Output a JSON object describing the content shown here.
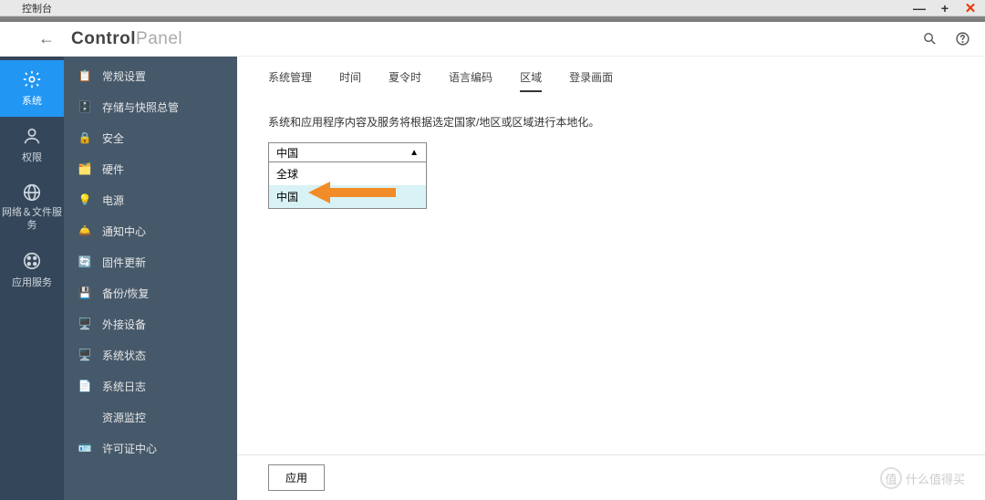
{
  "window": {
    "title": "控制台"
  },
  "header": {
    "brand_strong": "Control",
    "brand_light": "Panel"
  },
  "sidebar_left": {
    "items": [
      {
        "label": "系统",
        "icon": "gear"
      },
      {
        "label": "权限",
        "icon": "user"
      },
      {
        "label": "网络＆文件服务",
        "icon": "globe"
      },
      {
        "label": "应用服务",
        "icon": "grid"
      }
    ],
    "active_index": 0
  },
  "sidebar_mid": {
    "items": [
      {
        "label": "常规设置",
        "icon": "clipboard"
      },
      {
        "label": "存储与快照总管",
        "icon": "storage"
      },
      {
        "label": "安全",
        "icon": "lock"
      },
      {
        "label": "硬件",
        "icon": "chip"
      },
      {
        "label": "电源",
        "icon": "bulb"
      },
      {
        "label": "通知中心",
        "icon": "bell"
      },
      {
        "label": "固件更新",
        "icon": "refresh"
      },
      {
        "label": "备份/恢复",
        "icon": "backup"
      },
      {
        "label": "外接设备",
        "icon": "monitor"
      },
      {
        "label": "系统状态",
        "icon": "display"
      },
      {
        "label": "系统日志",
        "icon": "log"
      },
      {
        "label": "资源监控",
        "icon": "none"
      },
      {
        "label": "许可证中心",
        "icon": "license"
      }
    ]
  },
  "tabs": {
    "items": [
      "系统管理",
      "时间",
      "夏令时",
      "语言编码",
      "区域",
      "登录画面"
    ],
    "active_index": 4
  },
  "main": {
    "description": "系统和应用程序内容及服务将根据选定国家/地区或区域进行本地化。",
    "select_value": "中国",
    "options": [
      "全球",
      "中国"
    ],
    "highlight_index": 1
  },
  "footer": {
    "apply_label": "应用"
  },
  "watermark": {
    "glyph": "值",
    "text": "什么值得买"
  }
}
